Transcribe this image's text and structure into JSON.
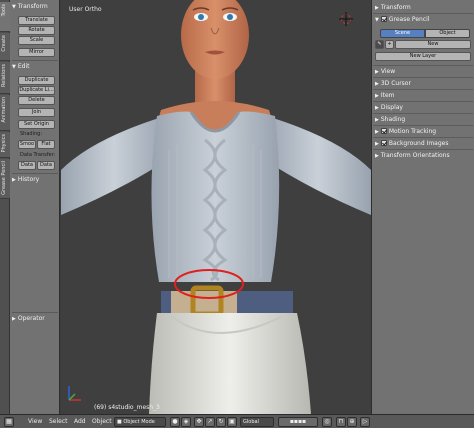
{
  "vertical_tabs": [
    "Tools",
    "Create",
    "Relations",
    "Animation",
    "Physics",
    "Grease Pencil"
  ],
  "toolshelf": {
    "transform_header": "Transform",
    "transform_buttons": [
      "Translate",
      "Rotate",
      "Scale",
      "Mirror"
    ],
    "edit_header": "Edit",
    "edit_buttons": [
      "Duplicate",
      "Duplicate Li...",
      "Delete",
      "Join"
    ],
    "set_origin": "Set Origin",
    "shading_label": "Shading:",
    "shading_buttons": [
      "Smoo",
      "Flat"
    ],
    "data_transfer_label": "Data Transfer:",
    "data_transfer_buttons": [
      "Data",
      "Data"
    ],
    "history_header": "History",
    "operator_header": "Operator"
  },
  "viewport": {
    "view_label": "User Ortho",
    "object_label": "(69) s4studio_mesh_3",
    "highlight_color": "#e0201c"
  },
  "properties": {
    "transform_header": "Transform",
    "grease_pencil_header": "Grease Pencil",
    "scene_tab": "Scene",
    "object_tab": "Object",
    "new_button": "New",
    "new_layer_button": "New Layer",
    "panels": [
      "View",
      "3D Cursor",
      "Item",
      "Display",
      "Shading"
    ],
    "motion_tracking": "Motion Tracking",
    "background_images": "Background Images",
    "transform_orientations": "Transform Orientations"
  },
  "header": {
    "view_menu": "View",
    "select_menu": "Select",
    "add_menu": "Add",
    "object_menu": "Object",
    "mode": "Object Mode",
    "orientation": "Global"
  },
  "colors": {
    "accent": "#5680c2",
    "panel_bg": "#727272",
    "viewport_bg": "#3f3f3f"
  }
}
